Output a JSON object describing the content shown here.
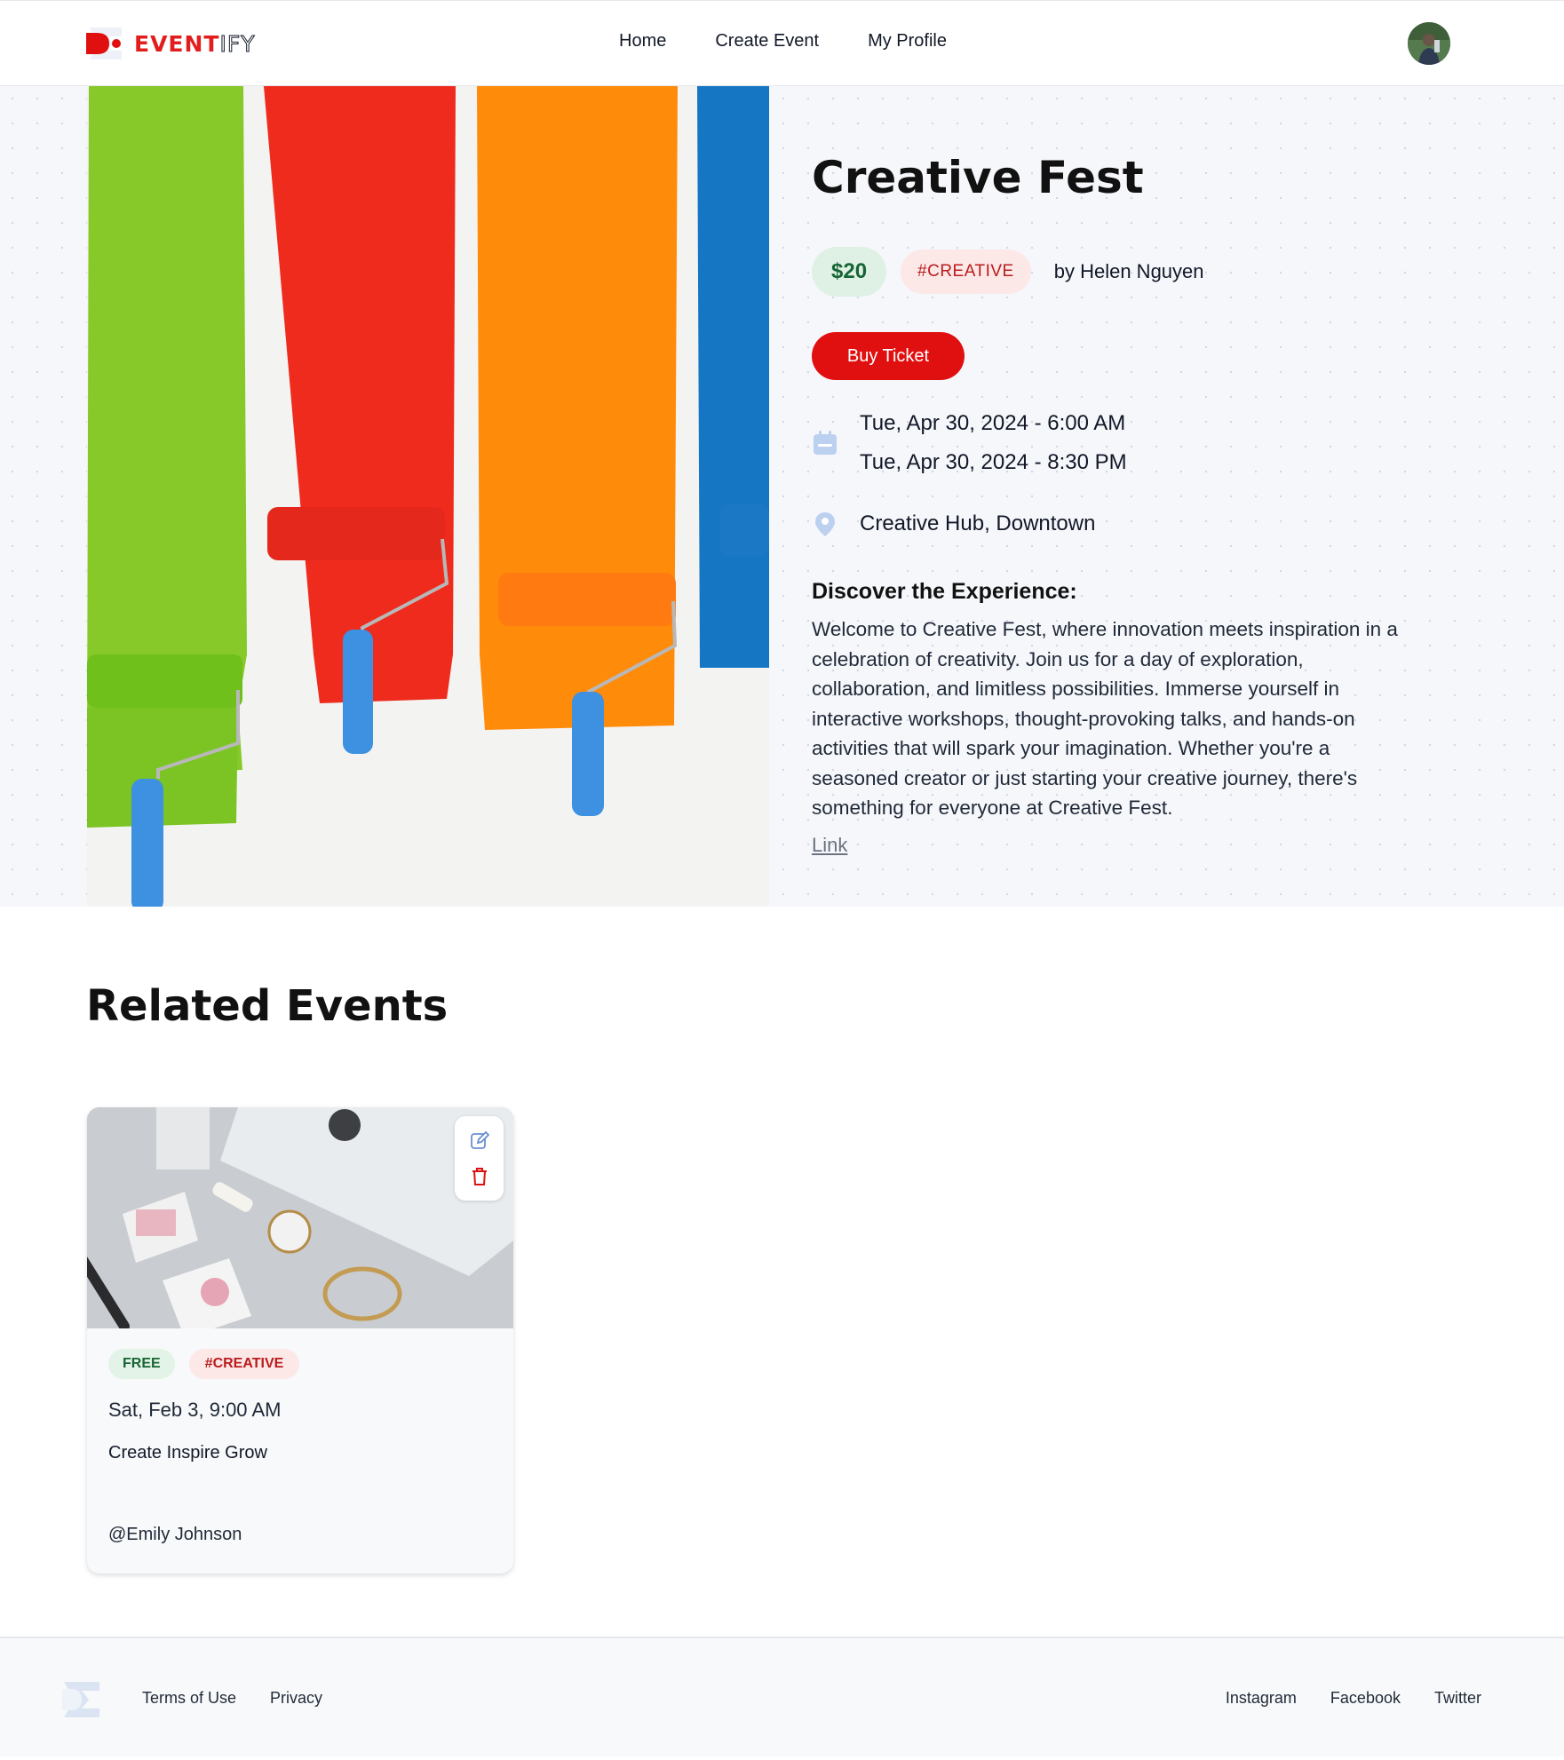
{
  "brand": {
    "name_part1": "EVENT",
    "name_part2": "IFY"
  },
  "nav": {
    "home": "Home",
    "create_event": "Create Event",
    "my_profile": "My Profile"
  },
  "event": {
    "title": "Creative Fest",
    "price": "$20",
    "tag": "#CREATIVE",
    "organizer": "by Helen Nguyen",
    "buy_label": "Buy Ticket",
    "start": "Tue, Apr 30, 2024 - 6:00 AM",
    "end": "Tue, Apr 30, 2024 - 8:30 PM",
    "location": "Creative Hub, Downtown",
    "description_heading": "Discover the Experience:",
    "description": "Welcome to Creative Fest, where innovation meets inspiration in a celebration of creativity. Join us for a day of exploration, collaboration, and limitless possibilities. Immerse yourself in interactive workshops, thought-provoking talks, and hands-on activities that will spark your imagination. Whether you're a seasoned creator or just starting your creative journey, there's something for everyone at Creative Fest.",
    "link_label": "Link"
  },
  "related": {
    "heading": "Related Events",
    "cards": [
      {
        "price": "FREE",
        "tag": "#CREATIVE",
        "date": "Sat, Feb 3, 9:00 AM",
        "name": "Create Inspire Grow",
        "organizer": "@Emily Johnson"
      }
    ]
  },
  "footer": {
    "terms": "Terms of Use",
    "privacy": "Privacy",
    "instagram": "Instagram",
    "facebook": "Facebook",
    "twitter": "Twitter"
  },
  "colors": {
    "accent": "#e01010",
    "price_green": "#166534",
    "tag_red": "#b91c1c",
    "icon_blue": "#bcd0f0"
  },
  "icons": [
    "logo-icon",
    "avatar",
    "calendar-icon",
    "location-pin-icon",
    "edit-icon",
    "trash-icon"
  ]
}
